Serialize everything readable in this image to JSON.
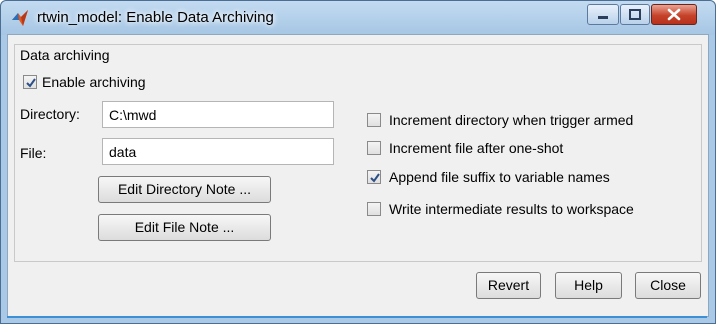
{
  "window": {
    "title": "rtwin_model: Enable Data Archiving",
    "icon": "matlab-icon",
    "controls": [
      "minimize-icon",
      "maximize-icon",
      "close-icon"
    ]
  },
  "group": {
    "label": "Data archiving"
  },
  "enable_archiving": {
    "label": "Enable archiving",
    "checked": true
  },
  "directory": {
    "label": "Directory:",
    "value": "C:\\mwd"
  },
  "file": {
    "label": "File:",
    "value": "data"
  },
  "buttons": {
    "edit_directory_note": "Edit Directory Note ...",
    "edit_file_note": "Edit File Note ...",
    "revert": "Revert",
    "help": "Help",
    "close": "Close"
  },
  "options": [
    {
      "label": "Increment directory when trigger armed",
      "checked": false
    },
    {
      "label": "Increment file after one-shot",
      "checked": false
    },
    {
      "label": "Append file suffix to variable names",
      "checked": true
    },
    {
      "label": "Write intermediate results to workspace",
      "checked": false
    }
  ],
  "colors": {
    "titlebar": "#a9c9e6",
    "client": "#f0f0f0",
    "close_button": "#c6432a"
  }
}
